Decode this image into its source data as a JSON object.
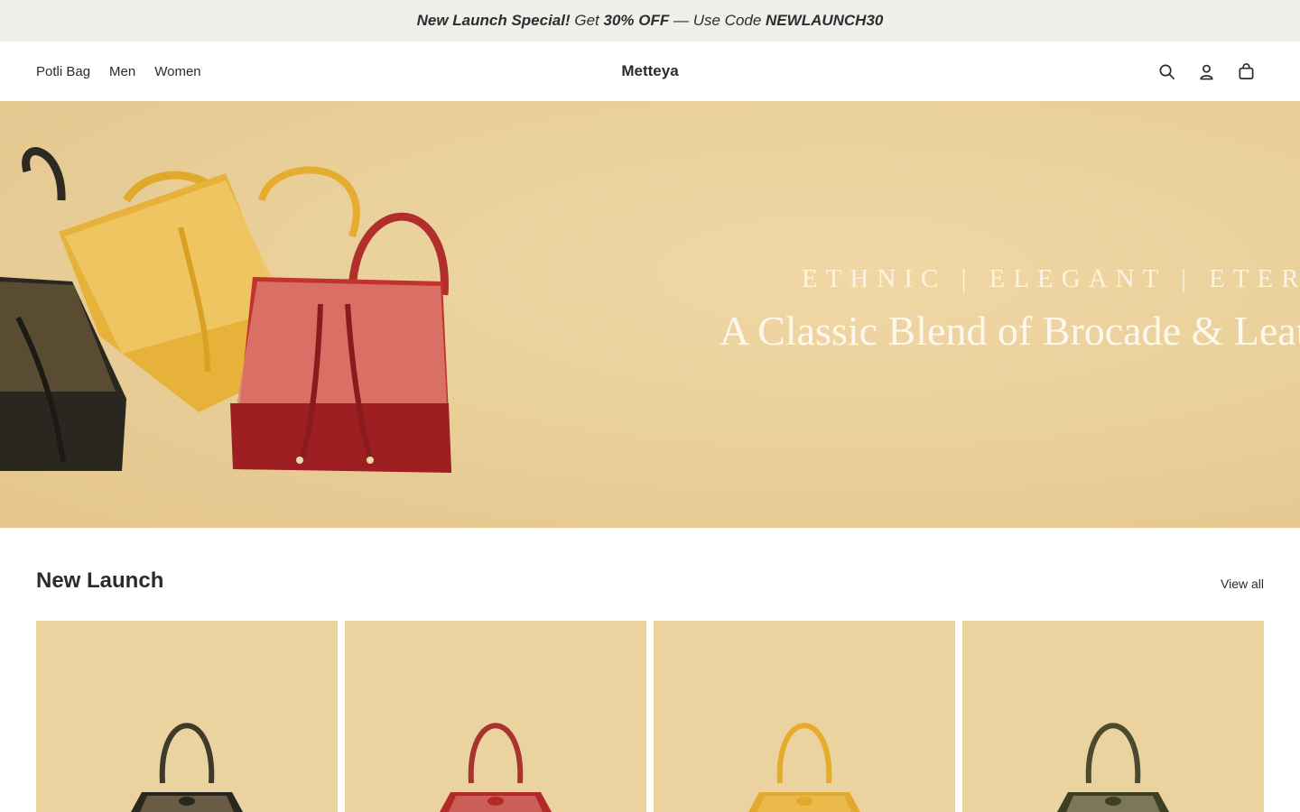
{
  "announcement": {
    "part1": "New Launch Special!",
    "part2": " Get ",
    "part3": "30% OFF",
    "part4": " — Use Code ",
    "part5": "NEWLAUNCH30"
  },
  "nav": {
    "items": [
      {
        "label": "Potli Bag"
      },
      {
        "label": "Men"
      },
      {
        "label": "Women"
      }
    ]
  },
  "header": {
    "logo": "Metteya",
    "icons": [
      "search-icon",
      "account-icon",
      "cart-icon"
    ]
  },
  "hero": {
    "tagline": "ETHNIC | ELEGANT | ETERNAL",
    "title": "A Classic Blend of Brocade & Leather"
  },
  "new_launch": {
    "title": "New Launch",
    "view_all": "View all",
    "products": [
      {
        "color_name": "black-gold",
        "bag_color": "#2a2620",
        "pattern_color": "#b9a070",
        "handle_color": "#3f3a2c"
      },
      {
        "color_name": "red",
        "bag_color": "#b4282a",
        "pattern_color": "#e7a08f",
        "handle_color": "#a8342f"
      },
      {
        "color_name": "yellow",
        "bag_color": "#e3a92e",
        "pattern_color": "#f3cf73",
        "handle_color": "#e5ab2a"
      },
      {
        "color_name": "olive-sequin",
        "bag_color": "#3e3f22",
        "pattern_color": "#c7bf9a",
        "handle_color": "#4b4a2e"
      }
    ]
  },
  "colors": {
    "announcement_bg": "#eef0ec",
    "hero_bg": "#ead09a",
    "card_bg": "#ebd3a0",
    "text": "#2b2b2b"
  }
}
